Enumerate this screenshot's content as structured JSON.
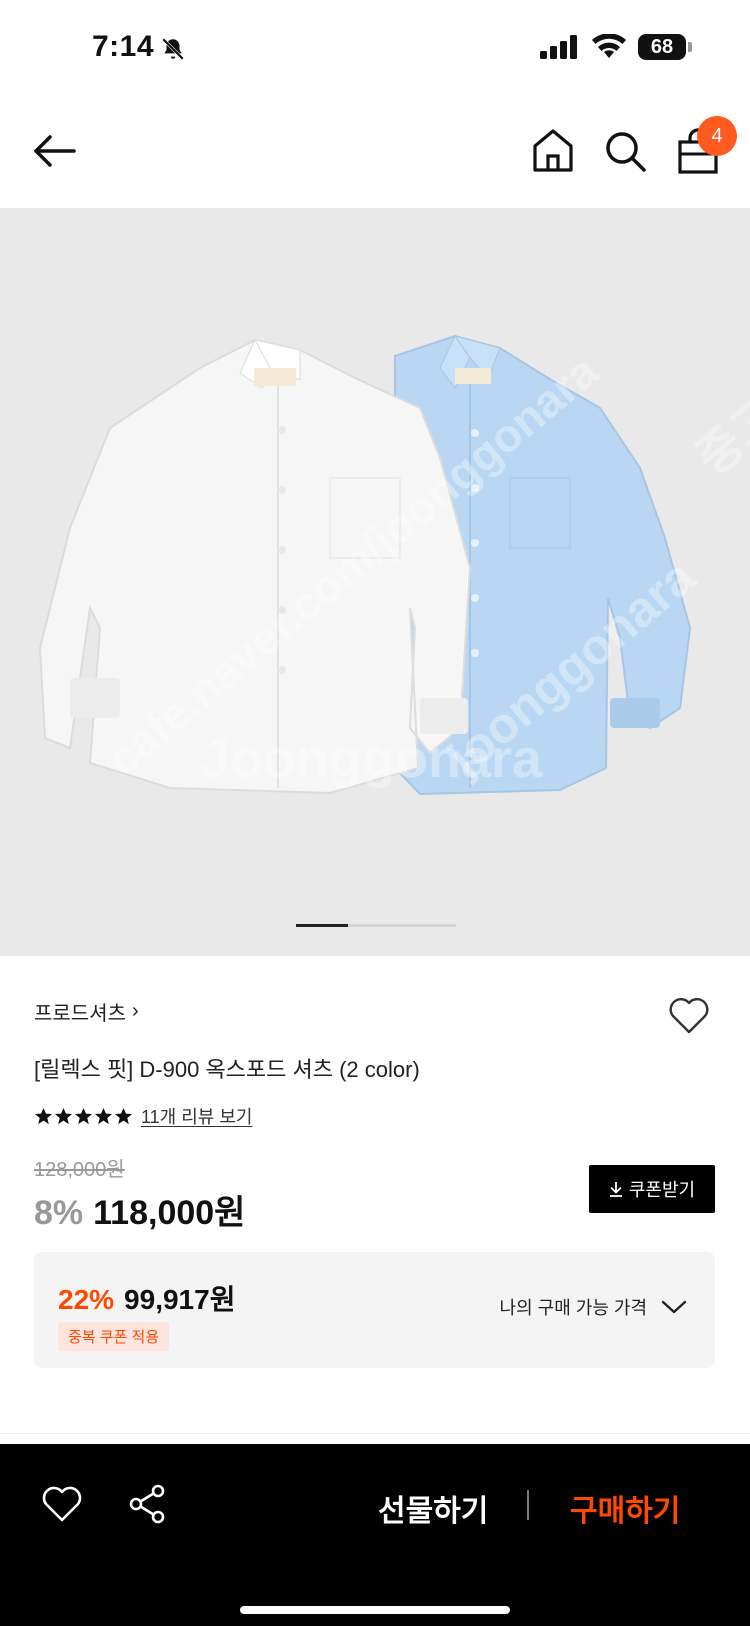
{
  "status_bar": {
    "time": "7:14",
    "battery": "68"
  },
  "header": {
    "cart_count": "4"
  },
  "image": {
    "watermark_lines": [
      "Joonggonara",
      "cafe.naver.com/joonggonara",
      "joonggonara",
      "중고"
    ]
  },
  "product": {
    "brand": "프로드셔츠",
    "brand_chevron": "›",
    "title": "[릴렉스 핏] D-900 옥스포드 셔츠 (2 color)",
    "rating_stars": 5,
    "review_link": "11개 리뷰 보기",
    "original_price": "128,000원",
    "discount": "8%",
    "price": "118,000원",
    "coupon_button": "쿠폰받기"
  },
  "my_price": {
    "discount": "22%",
    "price": "99,917원",
    "badge": "중복 쿠폰 적용",
    "toggle_label": "나의 구매 가능 가격"
  },
  "bottom_bar": {
    "gift_label": "선물하기",
    "buy_label": "구매하기"
  },
  "colors": {
    "accent": "#ff4800",
    "badge": "#ff5a1f",
    "image_bg": "#e9e9e9",
    "white_shirt": "#f6f6f6",
    "blue_shirt": "#b9d7f3"
  }
}
